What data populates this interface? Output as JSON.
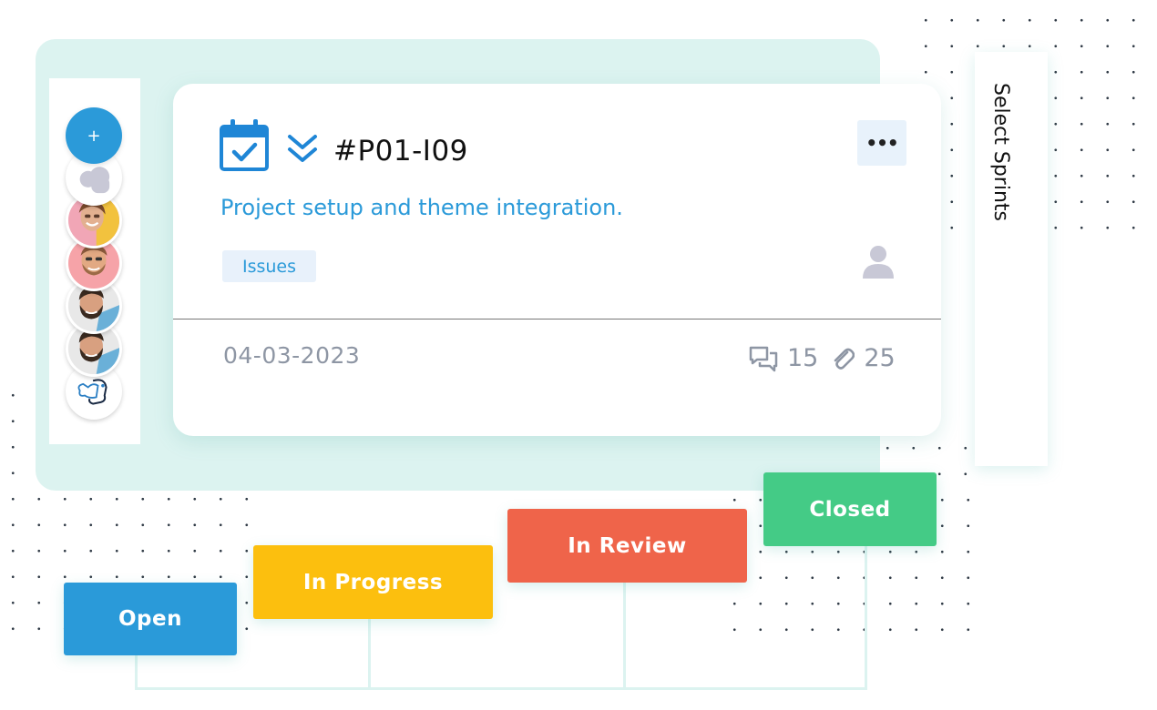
{
  "card": {
    "issue_id": "#P01-I09",
    "description": "Project setup and theme integration.",
    "tag": "Issues",
    "date": "04-03-2023",
    "comments_count": "15",
    "attachments_count": "25",
    "more_label": "•••",
    "icons": [
      "calendar-check-icon",
      "chevrons-down-icon",
      "user-icon",
      "comments-icon",
      "paperclip-icon"
    ]
  },
  "avatars": {
    "add_label": "+",
    "items": [
      "placeholder-avatar",
      "woman-avatar",
      "man-avatar",
      "bearded-man-avatar",
      "bearded-man-avatar-2",
      "logo-avatar"
    ]
  },
  "sidebar": {
    "label": "Select Sprints"
  },
  "statuses": [
    {
      "label": "Open",
      "color": "#2a9ad9"
    },
    {
      "label": "In Progress",
      "color": "#fcbf0e"
    },
    {
      "label": "In Review",
      "color": "#ef644a"
    },
    {
      "label": "Closed",
      "color": "#44cb86"
    }
  ],
  "colors": {
    "accent": "#2b9ad9",
    "backdrop": "#dcf3f0",
    "muted": "#8e96a4"
  }
}
